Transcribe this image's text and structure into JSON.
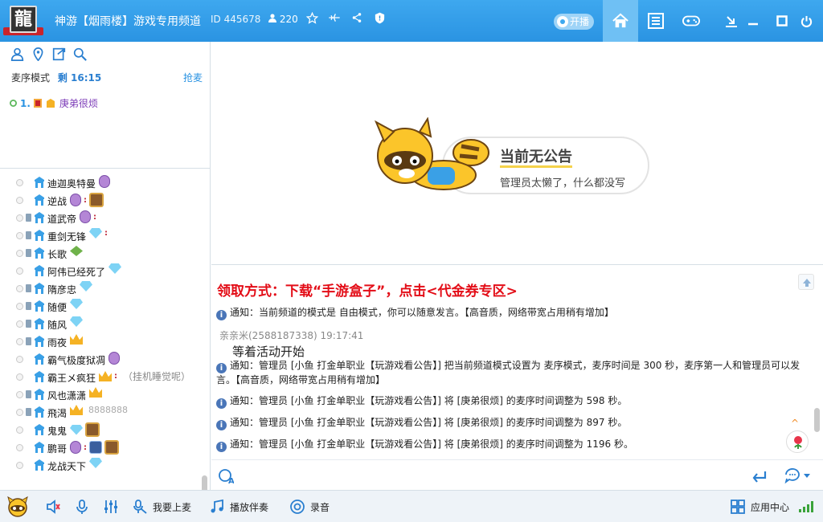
{
  "titlebar": {
    "logo_char": "龍",
    "title": "神游【烟雨楼】游戏专用频道",
    "channel_id": "ID 445678",
    "user_count": "220",
    "live_label": "开播"
  },
  "left_panel": {
    "mode_label": "麦序模式",
    "remaining": "剩 16:15",
    "grab_label": "抢麦",
    "queue": [
      {
        "num": "1.",
        "name": "庚弟很烦"
      }
    ],
    "members": [
      {
        "name": "迪迦奥特曼",
        "badges": [
          "shield"
        ],
        "mic": false
      },
      {
        "name": "逆战",
        "badges": [
          "shield-dots",
          "knight"
        ],
        "mic": false
      },
      {
        "name": "道武帝",
        "badges": [
          "shield-dots"
        ],
        "mic": true
      },
      {
        "name": "重剑无锋",
        "badges": [
          "gem-dots"
        ],
        "mic": true
      },
      {
        "name": "长歌",
        "badges": [
          "leaf"
        ],
        "mic": true
      },
      {
        "name": "阿伟已经死了",
        "badges": [
          "gem"
        ],
        "mic": false
      },
      {
        "name": "隋彦忠",
        "badges": [
          "gem"
        ],
        "mic": true
      },
      {
        "name": "随便",
        "badges": [
          "gem"
        ],
        "mic": true
      },
      {
        "name": "随风",
        "badges": [
          "gem"
        ],
        "mic": true
      },
      {
        "name": "雨夜",
        "badges": [
          "crown"
        ],
        "mic": true
      },
      {
        "name": "霸气极度狱凋",
        "badges": [
          "shield"
        ],
        "mic": false
      },
      {
        "name": "霸王メ疯狂",
        "badges": [
          "crown-dots"
        ],
        "mic": false,
        "aside": "（挂机睡觉呢）"
      },
      {
        "name": "风也潇潇",
        "badges": [
          "crown"
        ],
        "mic": true
      },
      {
        "name": "飛渴",
        "badges": [
          "crown"
        ],
        "mic": true,
        "idnum": "8888888"
      },
      {
        "name": "鬼鬼",
        "badges": [
          "gem",
          "knight"
        ],
        "mic": false
      },
      {
        "name": "鹏哥",
        "badges": [
          "shield-dots",
          "blue",
          "knight"
        ],
        "mic": false
      },
      {
        "name": "龙战天下",
        "badges": [
          "gem"
        ],
        "mic": false
      }
    ]
  },
  "notice": {
    "title": "当前无公告",
    "subtitle": "管理员太懒了，什么都没写"
  },
  "chat": {
    "cutoff": "",
    "promo": "领取方式：下载“手游盒子”，点击<代金券专区>",
    "notice1": "通知：当前频道的模式是 自由模式，你可以随意发言。【高音质，网络带宽占用稍有增加】",
    "sender": "亲亲米(2588187338) 19:17:41",
    "message": "等着活动开始",
    "notice2": "通知：管理员 [小鱼 打金单职业【玩游戏看公告】] 把当前频道模式设置为 麦序模式，麦序时间是 300 秒，麦序第一人和管理员可以发言。【高音质，网络带宽占用稍有增加】",
    "notice3": "通知：管理员 [小鱼 打金单职业【玩游戏看公告】] 将 [庚弟很烦] 的麦序时间调整为 598 秒。",
    "notice4": "通知：管理员 [小鱼 打金单职业【玩游戏看公告】] 将 [庚弟很烦] 的麦序时间调整为 897 秒。",
    "notice5": "通知：管理员 [小鱼 打金单职业【玩游戏看公告】] 将 [庚弟很烦] 的麦序时间调整为 1196 秒。"
  },
  "bottombar": {
    "queue_up": "我要上麦",
    "play_music": "播放伴奏",
    "record": "录音",
    "app_center": "应用中心"
  },
  "colors": {
    "title_blue": "#2a93e2",
    "promo_red": "#e30d17",
    "queue_purple": "#7b3ab7"
  }
}
